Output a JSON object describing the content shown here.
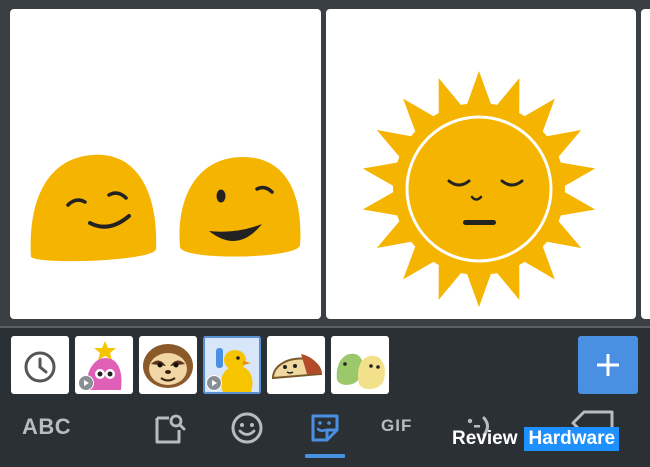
{
  "sticker_grid": {
    "stickers": [
      {
        "name": "two-blob-faces-sticker"
      },
      {
        "name": "sleeping-sun-sticker"
      }
    ]
  },
  "sticker_tray": {
    "items": [
      {
        "name": "recent-icon",
        "animated": false
      },
      {
        "name": "pink-star-blob-sticker",
        "animated": true
      },
      {
        "name": "sloth-sticker",
        "animated": false
      },
      {
        "name": "duck-sticker",
        "animated": true,
        "selected": true
      },
      {
        "name": "taco-cat-sticker",
        "animated": false
      },
      {
        "name": "green-yellow-chicks-sticker",
        "animated": false
      }
    ],
    "add_label": "+"
  },
  "bottom_bar": {
    "abc_label": "ABC",
    "gif_label": "GIF",
    "active_tab": "stickers"
  },
  "watermark": {
    "part1": "Review",
    "part2": "Hardware"
  },
  "colors": {
    "background": "#2b3035",
    "accent": "#4a90e2",
    "emoji_yellow": "#f5b400"
  }
}
